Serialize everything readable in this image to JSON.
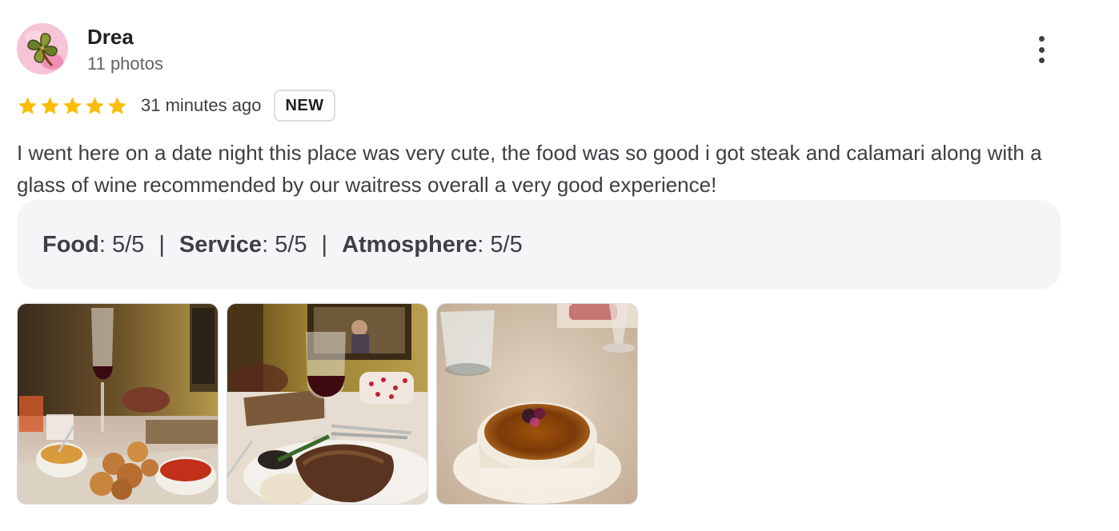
{
  "review": {
    "author": {
      "name": "Drea",
      "meta": "11 photos",
      "avatar_icon": "four-leaf-clover-icon"
    },
    "rating": 5,
    "rating_max": 5,
    "timestamp": "31 minutes ago",
    "badge": "NEW",
    "text": "I went here on a date night this place was very cute, the food was so good i got steak and calamari along with a glass of wine recommended by our waitress overall a very good experience!",
    "attributes": [
      {
        "key": "Food",
        "value": "5/5"
      },
      {
        "key": "Service",
        "value": "5/5"
      },
      {
        "key": "Atmosphere",
        "value": "5/5"
      }
    ],
    "separator": "|",
    "photos": [
      {
        "icon": "calamari-photo"
      },
      {
        "icon": "steak-photo"
      },
      {
        "icon": "creme-brulee-photo"
      }
    ]
  },
  "colors": {
    "star": "#fbbc04",
    "attribute_bg": "#f4f5f7",
    "badge_border": "#dadce0"
  },
  "icons": {
    "more": "more-vert-icon",
    "star": "star-icon"
  }
}
